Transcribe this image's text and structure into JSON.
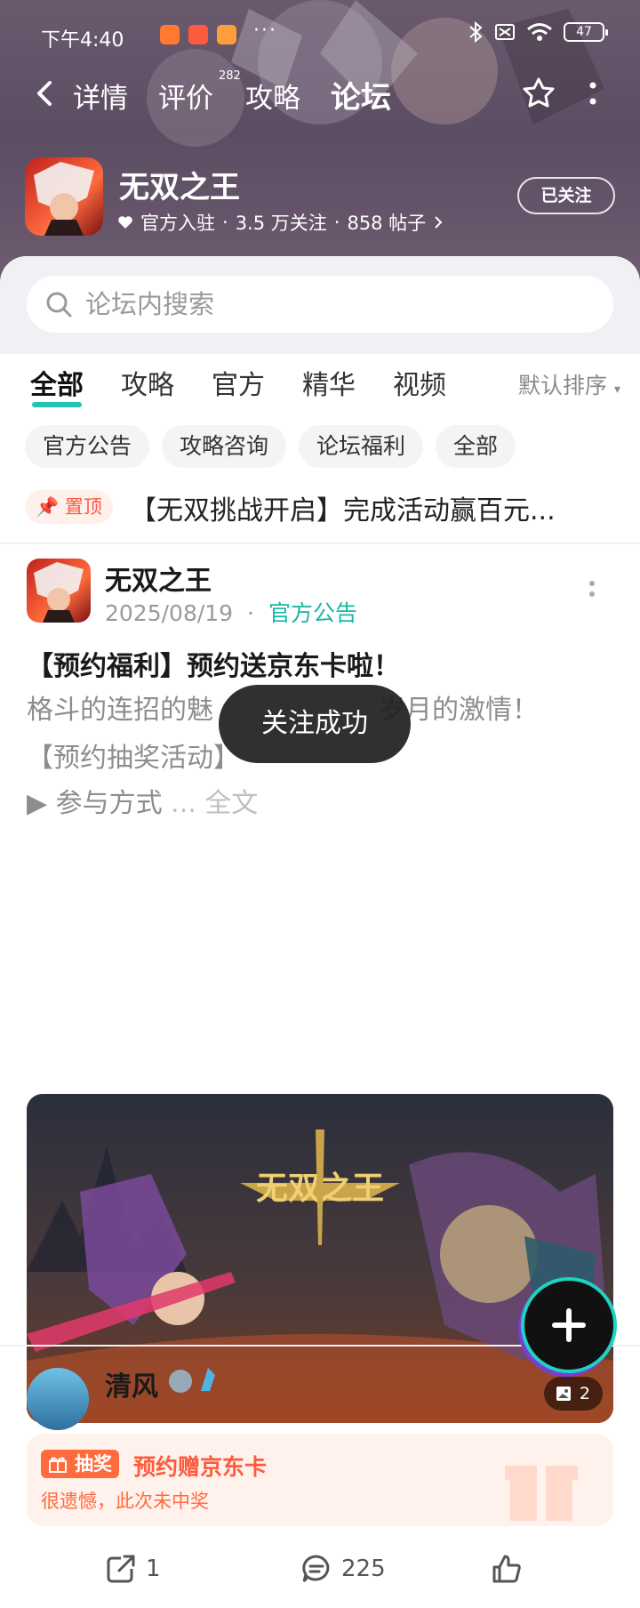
{
  "status_bar": {
    "time": "下午4:40",
    "battery": "47"
  },
  "nav": {
    "tabs": [
      {
        "label": "详情"
      },
      {
        "label": "评价"
      },
      {
        "label": "攻略"
      },
      {
        "label": "论坛"
      }
    ],
    "review_count": "282",
    "active_tab": "论坛"
  },
  "game": {
    "name": "无双之王",
    "verified_label": "官方入驻",
    "followers": "3.5 万关注",
    "posts": "858 帖子",
    "sep": "·",
    "follow_state": "已关注"
  },
  "search": {
    "placeholder": "论坛内搜索"
  },
  "categories": [
    {
      "label": "全部"
    },
    {
      "label": "攻略"
    },
    {
      "label": "官方"
    },
    {
      "label": "精华"
    },
    {
      "label": "视频"
    }
  ],
  "sort_label": "默认排序",
  "chips": [
    {
      "label": "官方公告"
    },
    {
      "label": "攻略咨询"
    },
    {
      "label": "论坛福利"
    },
    {
      "label": "全部"
    }
  ],
  "pinned": {
    "tag": "置顶",
    "text": "【无双挑战开启】完成活动赢百元..."
  },
  "post": {
    "author": "无双之王",
    "date": "2025/08/19",
    "sep": "·",
    "category": "官方公告",
    "title": "【预约福利】预约送京东卡啦！",
    "body_line1": "格斗的连招的魅",
    "body_line1_tail": "岁月的激情！",
    "body_line2": "【预约抽奖活动】",
    "readmore": "▶ 参与方式",
    "ellipsis": "...",
    "full_text": "全文",
    "image_count": "2",
    "image_title": "无双之王",
    "lottery": {
      "tag": "抽奖",
      "title": "预约赠京东卡",
      "subtitle": "很遗憾，此次未中奖"
    },
    "shares": "1",
    "comments": "225"
  },
  "next_post": {
    "author": "清风"
  },
  "toast": "关注成功",
  "colors": {
    "accent": "#1fc6b6",
    "orange": "#ff5a3c",
    "hero": "#5c4d63"
  }
}
